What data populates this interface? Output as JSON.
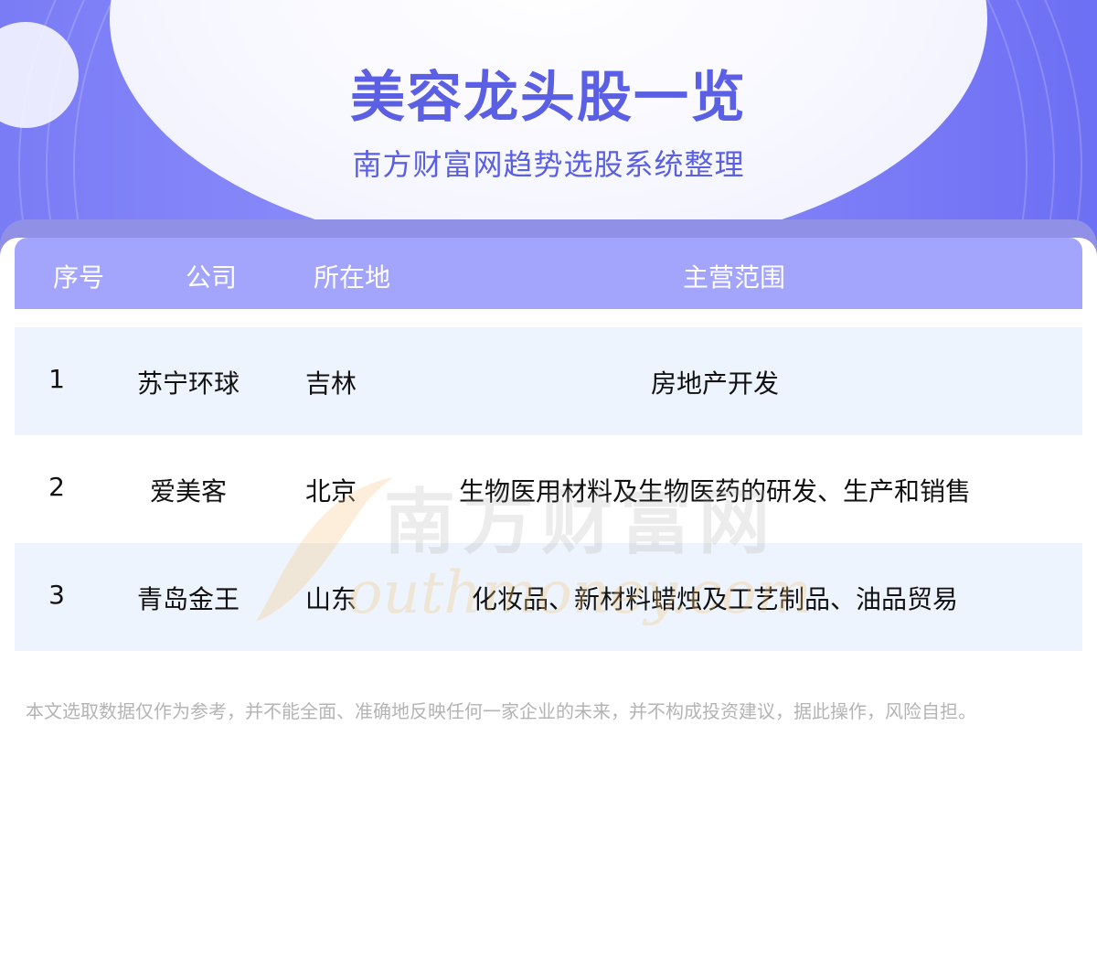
{
  "header": {
    "title": "美容龙头股一览",
    "subtitle": "南方财富网趋势选股系统整理"
  },
  "table": {
    "columns": [
      "序号",
      "公司",
      "所在地",
      "主营范围"
    ],
    "rows": [
      {
        "no": "1",
        "company": "苏宁环球",
        "location": "吉林",
        "scope": "房地产开发"
      },
      {
        "no": "2",
        "company": "爱美客",
        "location": "北京",
        "scope": "生物医用材料及生物医药的研发、生产和销售"
      },
      {
        "no": "3",
        "company": "青岛金王",
        "location": "山东",
        "scope": "化妆品、新材料蜡烛及工艺制品、油品贸易"
      }
    ]
  },
  "watermark": {
    "cn": "南方财富网",
    "en": "outhmoney.com"
  },
  "footer": {
    "disclaimer": "本文选取数据仅作为参考，并不能全面、准确地反映任何一家企业的未来，并不构成投资建议，据此操作，风险自担。"
  },
  "colors": {
    "accent": "#5a5fe4",
    "header_row": "#a3a5fd",
    "alt_row": "#eef4fd",
    "banner": "#7a7cf6",
    "watermark_orange": "#f4c37a"
  }
}
